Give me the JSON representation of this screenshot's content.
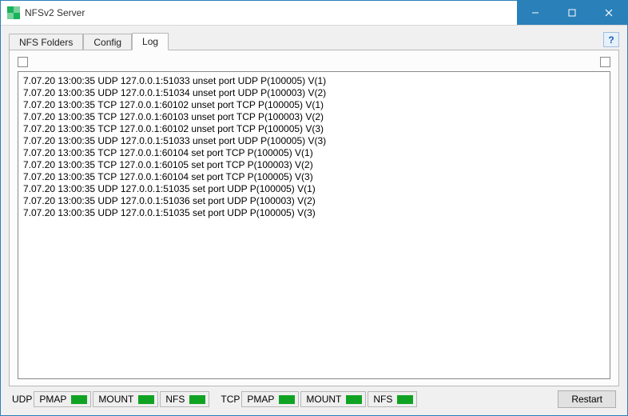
{
  "window": {
    "title": "NFSv2 Server"
  },
  "tabs": {
    "nfs_folders": "NFS Folders",
    "config": "Config",
    "log": "Log"
  },
  "help_label": "?",
  "log": {
    "lines": [
      "7.07.20 13:00:35 UDP 127.0.0.1:51033 unset port UDP P(100005) V(1)",
      "7.07.20 13:00:35 UDP 127.0.0.1:51034 unset port UDP P(100003) V(2)",
      "7.07.20 13:00:35 TCP 127.0.0.1:60102 unset port TCP P(100005) V(1)",
      "7.07.20 13:00:35 TCP 127.0.0.1:60103 unset port TCP P(100003) V(2)",
      "7.07.20 13:00:35 TCP 127.0.0.1:60102 unset port TCP P(100005) V(3)",
      "7.07.20 13:00:35 UDP 127.0.0.1:51033 unset port UDP P(100005) V(3)",
      "7.07.20 13:00:35 TCP 127.0.0.1:60104 set port TCP P(100005) V(1)",
      "7.07.20 13:00:35 TCP 127.0.0.1:60105 set port TCP P(100003) V(2)",
      "7.07.20 13:00:35 TCP 127.0.0.1:60104 set port TCP P(100005) V(3)",
      "7.07.20 13:00:35 UDP 127.0.0.1:51035 set port UDP P(100005) V(1)",
      "7.07.20 13:00:35 UDP 127.0.0.1:51036 set port UDP P(100003) V(2)",
      "7.07.20 13:00:35 UDP 127.0.0.1:51035 set port UDP P(100005) V(3)"
    ]
  },
  "status": {
    "udp_label": "UDP",
    "tcp_label": "TCP",
    "pmap": "PMAP",
    "mount": "MOUNT",
    "nfs": "NFS",
    "restart": "Restart"
  }
}
